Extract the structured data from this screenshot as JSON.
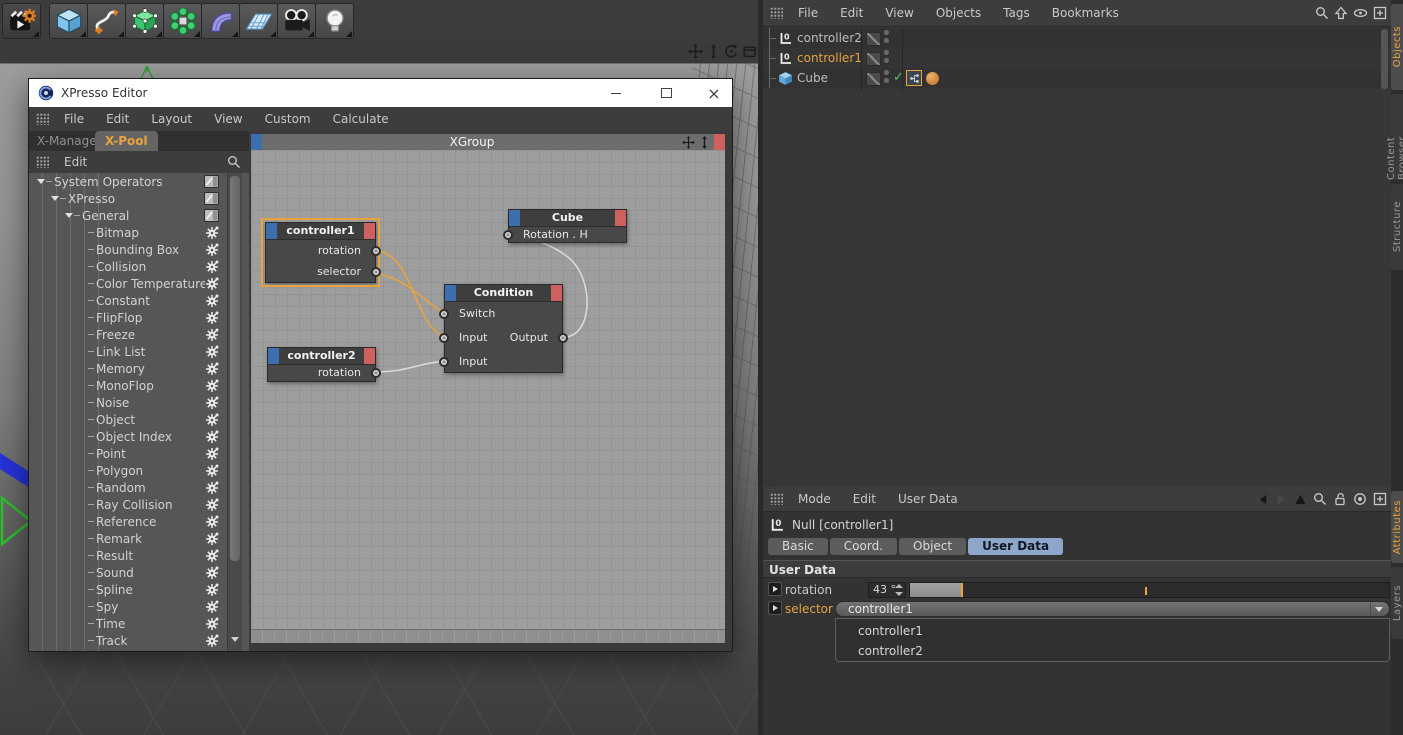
{
  "colors": {
    "accent_orange": "#e8a33d",
    "node_header_blue": "#3d6fae",
    "node_header_red": "#cf6060",
    "wire_orange": "#e8a33d",
    "wire_gray": "#dcdcdc",
    "active_tab_blue": "#8da7cb",
    "check_green": "#49c856"
  },
  "main_toolbar": {
    "tools": [
      "render-settings",
      "cube-primitive",
      "spline-pen",
      "model-edit",
      "array-cloner",
      "bend-deformer",
      "floor-environment",
      "camera",
      "light"
    ]
  },
  "viewport": {
    "nav_icons": [
      "move-view",
      "zoom-view",
      "rotate-view",
      "maximize-view"
    ]
  },
  "xpresso_window": {
    "title": "XPresso Editor",
    "menus": [
      "File",
      "Edit",
      "Layout",
      "View",
      "Custom",
      "Calculate"
    ],
    "tabs": [
      {
        "label": "X-Manager"
      },
      {
        "label": "X-Pool",
        "active": true
      }
    ],
    "pool": {
      "header": "Edit",
      "tree": [
        {
          "label": "System Operators",
          "depth": 0,
          "type": "folder"
        },
        {
          "label": "XPresso",
          "depth": 1,
          "type": "folder"
        },
        {
          "label": "General",
          "depth": 2,
          "type": "folder"
        },
        {
          "label": "Bitmap",
          "depth": 3,
          "type": "op"
        },
        {
          "label": "Bounding Box",
          "depth": 3,
          "type": "op"
        },
        {
          "label": "Collision",
          "depth": 3,
          "type": "op"
        },
        {
          "label": "Color Temperature",
          "depth": 3,
          "type": "op"
        },
        {
          "label": "Constant",
          "depth": 3,
          "type": "op"
        },
        {
          "label": "FlipFlop",
          "depth": 3,
          "type": "op"
        },
        {
          "label": "Freeze",
          "depth": 3,
          "type": "op"
        },
        {
          "label": "Link List",
          "depth": 3,
          "type": "op"
        },
        {
          "label": "Memory",
          "depth": 3,
          "type": "op"
        },
        {
          "label": "MonoFlop",
          "depth": 3,
          "type": "op"
        },
        {
          "label": "Noise",
          "depth": 3,
          "type": "op"
        },
        {
          "label": "Object",
          "depth": 3,
          "type": "op"
        },
        {
          "label": "Object Index",
          "depth": 3,
          "type": "op"
        },
        {
          "label": "Point",
          "depth": 3,
          "type": "op"
        },
        {
          "label": "Polygon",
          "depth": 3,
          "type": "op"
        },
        {
          "label": "Random",
          "depth": 3,
          "type": "op"
        },
        {
          "label": "Ray Collision",
          "depth": 3,
          "type": "op"
        },
        {
          "label": "Reference",
          "depth": 3,
          "type": "op"
        },
        {
          "label": "Remark",
          "depth": 3,
          "type": "op"
        },
        {
          "label": "Result",
          "depth": 3,
          "type": "op"
        },
        {
          "label": "Sound",
          "depth": 3,
          "type": "op"
        },
        {
          "label": "Spline",
          "depth": 3,
          "type": "op"
        },
        {
          "label": "Spy",
          "depth": 3,
          "type": "op"
        },
        {
          "label": "Time",
          "depth": 3,
          "type": "op"
        },
        {
          "label": "Track",
          "depth": 3,
          "type": "op"
        }
      ]
    },
    "graph": {
      "group_title": "XGroup",
      "nodes": {
        "controller1": {
          "title": "controller1",
          "outputs": [
            "rotation",
            "selector"
          ],
          "selected": true
        },
        "controller2": {
          "title": "controller2",
          "outputs": [
            "rotation"
          ]
        },
        "condition": {
          "title": "Condition",
          "inputs": [
            "Switch",
            "Input",
            "Input"
          ],
          "outputs": [
            "Output"
          ]
        },
        "cube": {
          "title": "Cube",
          "inputs": [
            "Rotation . H"
          ]
        }
      }
    }
  },
  "object_manager": {
    "menus": [
      "File",
      "Edit",
      "View",
      "Objects",
      "Tags",
      "Bookmarks"
    ],
    "toolbar_icons": [
      "search",
      "scroll-to-active",
      "eye",
      "add"
    ],
    "items": [
      {
        "label": "controller2",
        "type": "null"
      },
      {
        "label": "controller1",
        "type": "null",
        "selected": true
      },
      {
        "label": "Cube",
        "type": "cube",
        "check": true,
        "tags": true
      }
    ],
    "side_tabs": [
      {
        "label": "Objects",
        "active": true
      },
      {
        "label": "Content Browser"
      },
      {
        "label": "Structure"
      }
    ]
  },
  "attribute_manager": {
    "menus": [
      "Mode",
      "Edit",
      "User Data"
    ],
    "toolbar_icons": [
      "history-back",
      "history-forward",
      "up",
      "search",
      "lock",
      "record",
      "add"
    ],
    "object_label": "Null [controller1]",
    "tabs": [
      {
        "label": "Basic"
      },
      {
        "label": "Coord."
      },
      {
        "label": "Object"
      },
      {
        "label": "User Data",
        "active": true
      }
    ],
    "section_title": "User Data",
    "rotation": {
      "label": "rotation",
      "value": "43 °",
      "slider_fraction": 0.11,
      "tick_fraction": 0.49
    },
    "selector": {
      "label": "selector",
      "value": "controller1",
      "options": [
        "controller1",
        "controller2"
      ]
    },
    "side_tabs": [
      {
        "label": "Attributes",
        "active": true
      },
      {
        "label": "Layers"
      }
    ]
  }
}
